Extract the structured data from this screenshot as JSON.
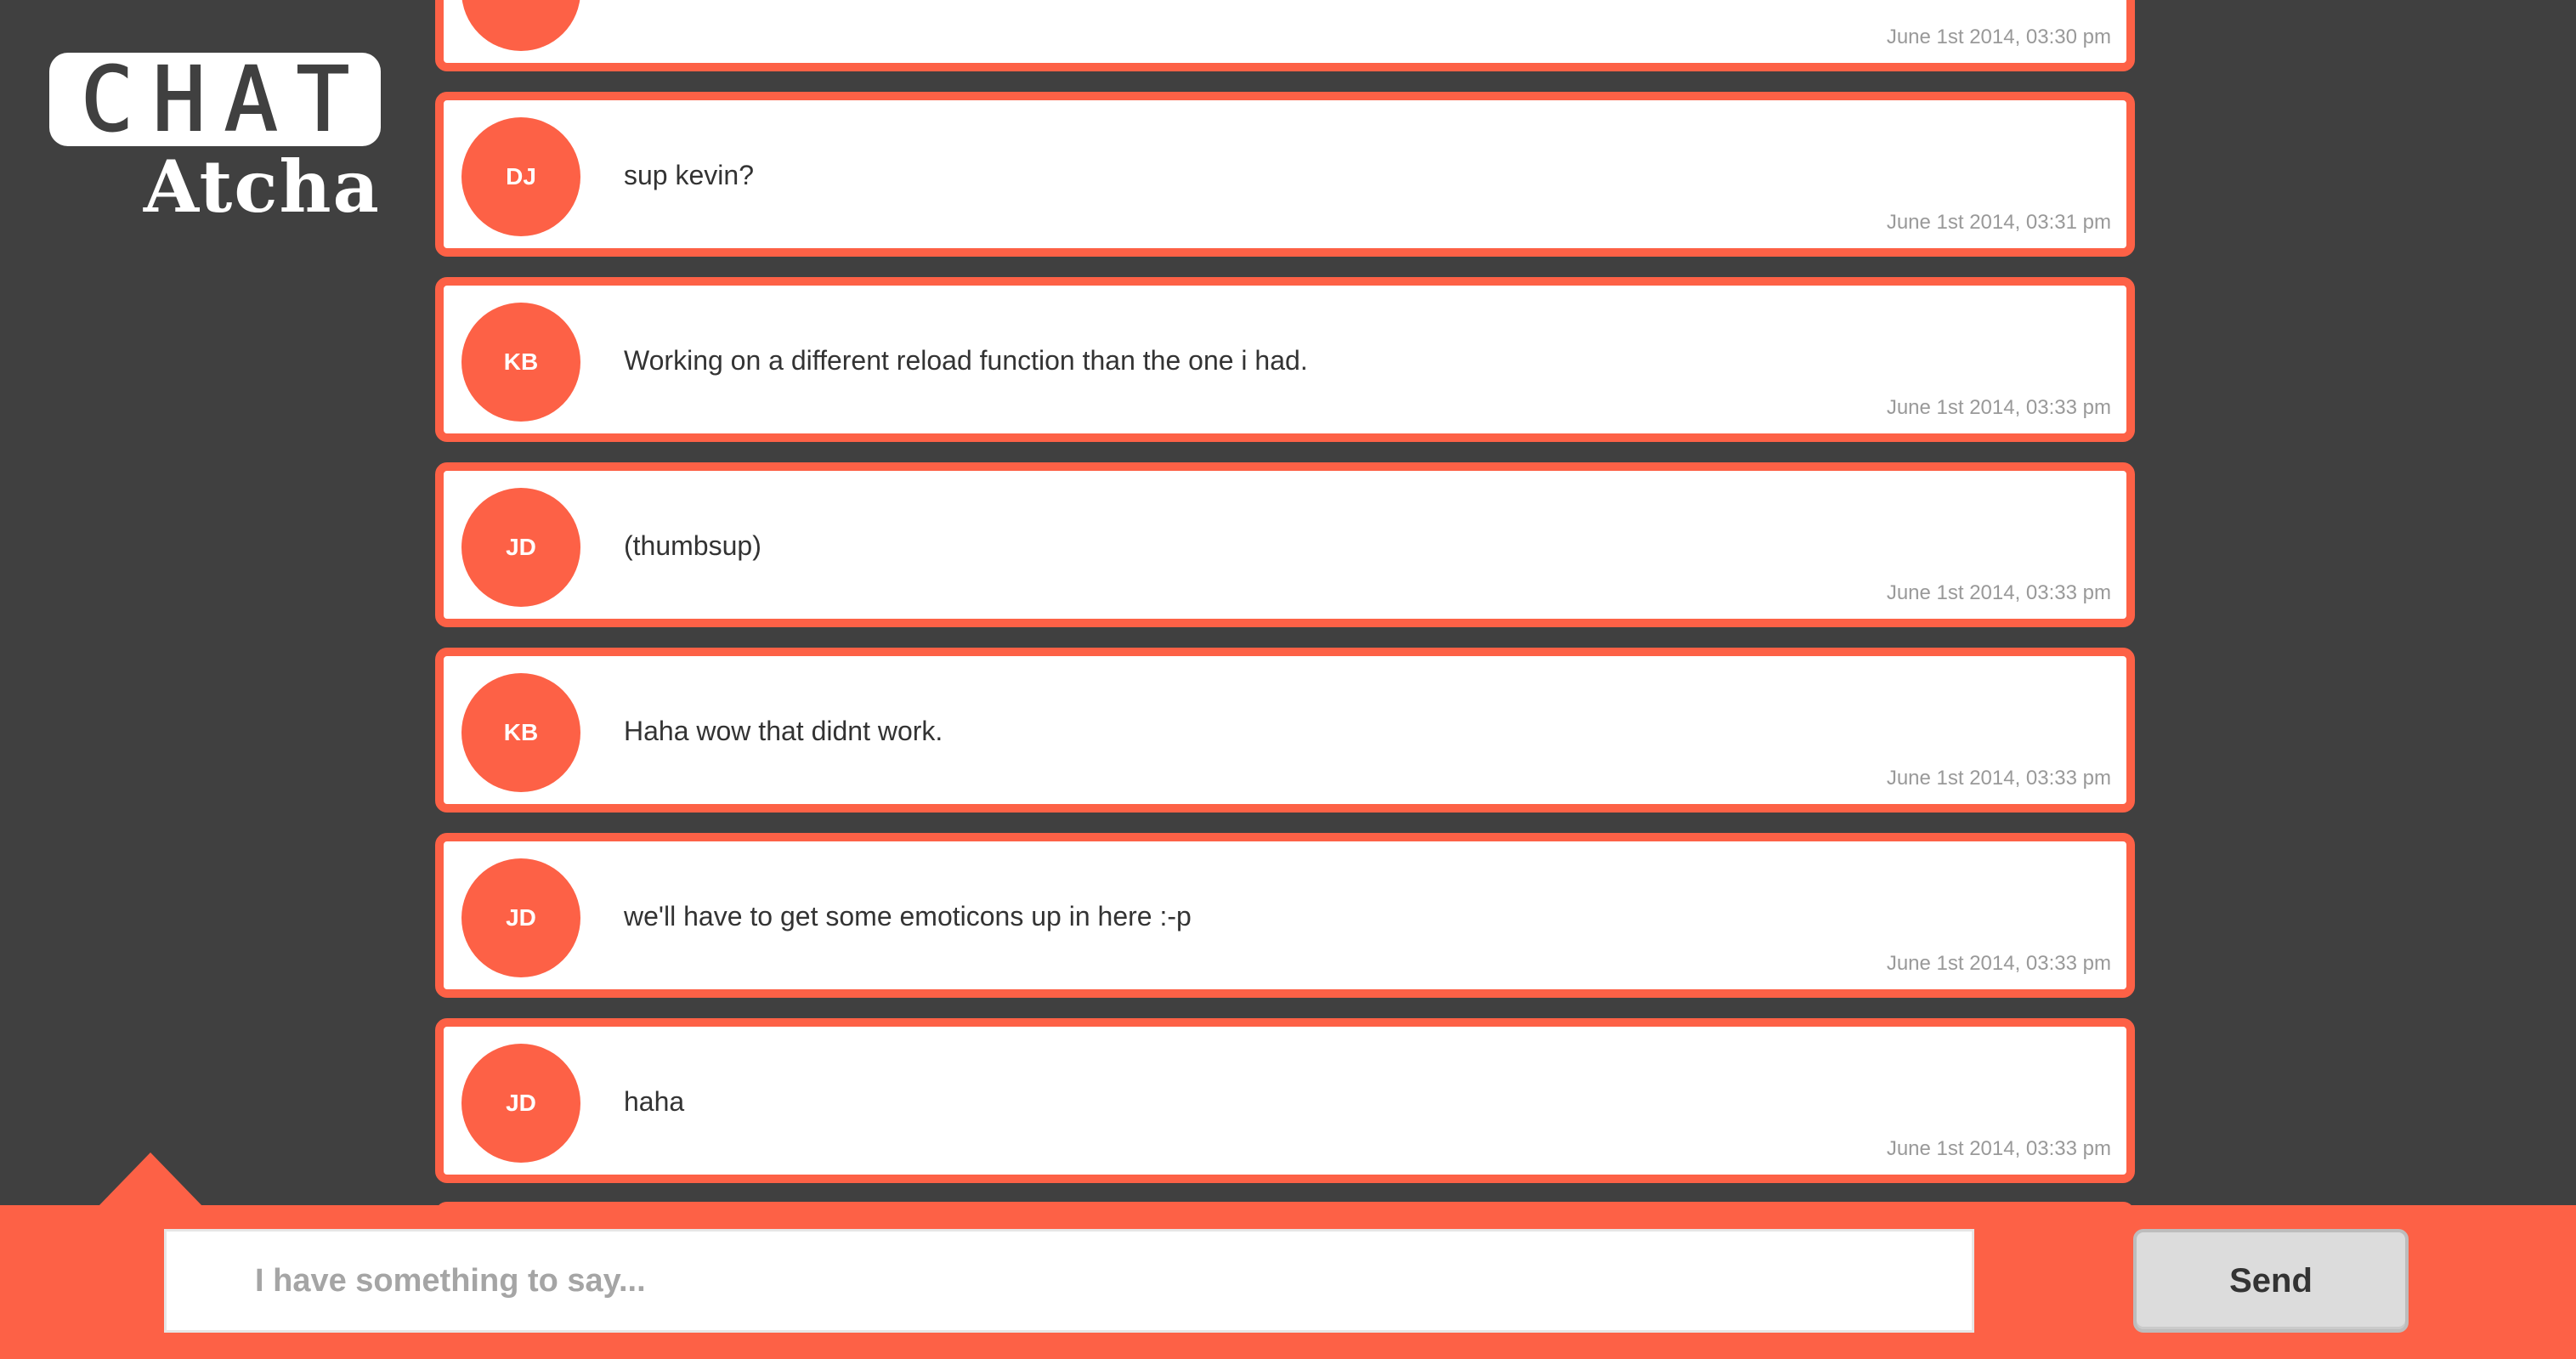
{
  "app": {
    "logo_top": "CHAT",
    "logo_bottom": "Atcha"
  },
  "colors": {
    "accent": "#fd6146",
    "background": "#404040",
    "card": "#ffffff",
    "button": "#dcdcdc"
  },
  "messages": [
    {
      "initials": "",
      "text": "",
      "time": "June 1st 2014, 03:30 pm"
    },
    {
      "initials": "DJ",
      "text": "sup kevin?",
      "time": "June 1st 2014, 03:31 pm"
    },
    {
      "initials": "KB",
      "text": "Working on a different reload function than the one i had.",
      "time": "June 1st 2014, 03:33 pm"
    },
    {
      "initials": "JD",
      "text": "(thumbsup)",
      "time": "June 1st 2014, 03:33 pm"
    },
    {
      "initials": "KB",
      "text": "Haha wow that didnt work.",
      "time": "June 1st 2014, 03:33 pm"
    },
    {
      "initials": "JD",
      "text": "we'll have to get some emoticons up in here :-p",
      "time": "June 1st 2014, 03:33 pm"
    },
    {
      "initials": "JD",
      "text": "haha",
      "time": "June 1st 2014, 03:33 pm"
    }
  ],
  "composer": {
    "placeholder": "I have something to say...",
    "value": "",
    "send_label": "Send"
  }
}
